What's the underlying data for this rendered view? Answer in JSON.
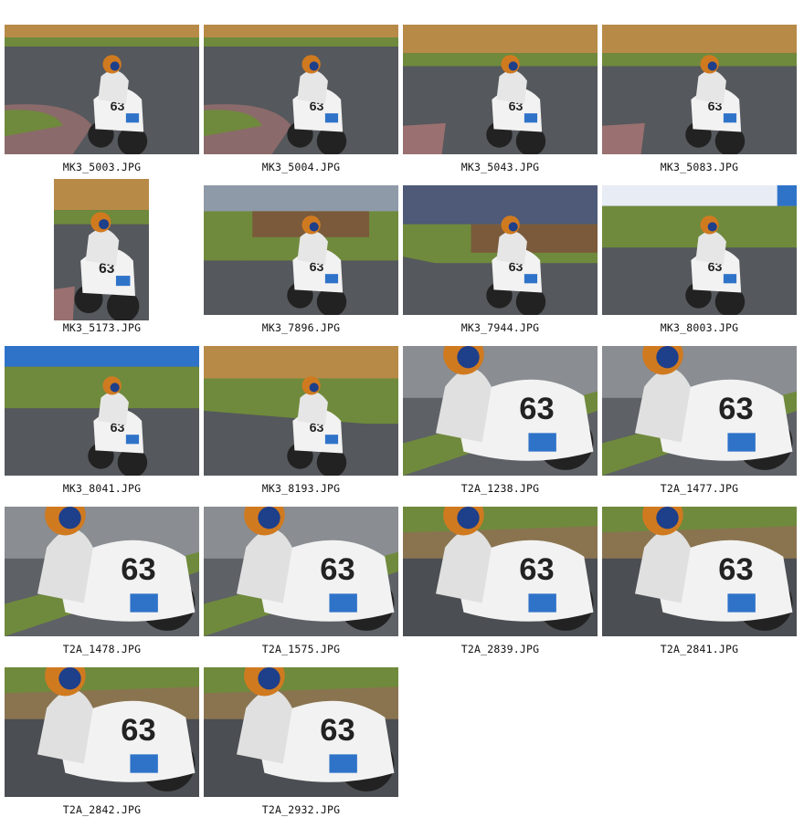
{
  "gallery": {
    "items": [
      {
        "filename": "MK3_5003.JPG",
        "orientation": "landscape",
        "scene": "track-curb"
      },
      {
        "filename": "MK3_5004.JPG",
        "orientation": "landscape",
        "scene": "track-curb"
      },
      {
        "filename": "MK3_5043.JPG",
        "orientation": "landscape",
        "scene": "track-wall"
      },
      {
        "filename": "MK3_5083.JPG",
        "orientation": "landscape",
        "scene": "track-wall"
      },
      {
        "filename": "MK3_5173.JPG",
        "orientation": "portrait",
        "scene": "track-wall"
      },
      {
        "filename": "MK3_7896.JPG",
        "orientation": "landscape",
        "scene": "grass-tyres"
      },
      {
        "filename": "MK3_7944.JPG",
        "orientation": "landscape",
        "scene": "grandstand"
      },
      {
        "filename": "MK3_8003.JPG",
        "orientation": "landscape",
        "scene": "banner"
      },
      {
        "filename": "MK3_8041.JPG",
        "orientation": "landscape",
        "scene": "banner-blue"
      },
      {
        "filename": "MK3_8193.JPG",
        "orientation": "landscape",
        "scene": "wall-grass"
      },
      {
        "filename": "T2A_1238.JPG",
        "orientation": "landscape",
        "scene": "close-grey"
      },
      {
        "filename": "T2A_1477.JPG",
        "orientation": "landscape",
        "scene": "close-grey"
      },
      {
        "filename": "T2A_1478.JPG",
        "orientation": "landscape",
        "scene": "close-grey"
      },
      {
        "filename": "T2A_1575.JPG",
        "orientation": "landscape",
        "scene": "close-grey"
      },
      {
        "filename": "T2A_2839.JPG",
        "orientation": "landscape",
        "scene": "close-grass"
      },
      {
        "filename": "T2A_2841.JPG",
        "orientation": "landscape",
        "scene": "close-grass"
      },
      {
        "filename": "T2A_2842.JPG",
        "orientation": "landscape",
        "scene": "close-grass"
      },
      {
        "filename": "T2A_2932.JPG",
        "orientation": "landscape",
        "scene": "close-grass"
      }
    ],
    "colors": {
      "asphalt": "#55585c",
      "grass": "#6f8a3c",
      "wall": "#b88a48",
      "bike": "#f2f2f2",
      "accent": "#2f73c9",
      "caption": "#111111"
    }
  }
}
